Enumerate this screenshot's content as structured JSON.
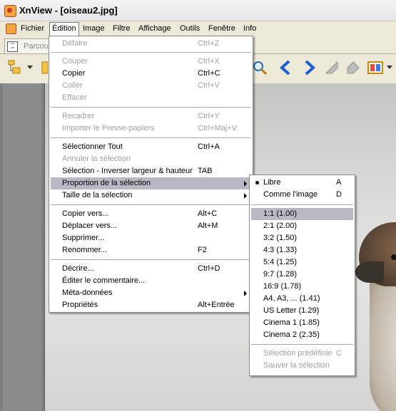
{
  "window": {
    "title": "XnView - [oiseau2.jpg]"
  },
  "menubar": [
    "Fichier",
    "Édition",
    "Image",
    "Filtre",
    "Affichage",
    "Outils",
    "Fenêtre",
    "Info"
  ],
  "tab": {
    "label": "Parcou"
  },
  "toolbar_icons": [
    "folder-tree-icon",
    "open-folder-icon",
    "zoom-icon",
    "prev-arrow-icon",
    "next-arrow-icon",
    "first-icon",
    "last-icon",
    "slideshow-icon"
  ],
  "edit_menu": {
    "items": [
      {
        "label": "Défaire",
        "shortcut": "Ctrl+Z",
        "enabled": false
      },
      {
        "label": "Couper",
        "shortcut": "Ctrl+X",
        "enabled": false
      },
      {
        "label": "Copier",
        "shortcut": "Ctrl+C",
        "enabled": true
      },
      {
        "label": "Coller",
        "shortcut": "Ctrl+V",
        "enabled": false
      },
      {
        "label": "Effacer",
        "shortcut": "",
        "enabled": false
      },
      {
        "label": "Recadrer",
        "shortcut": "Ctrl+Y",
        "enabled": false
      },
      {
        "label": "Importer le Presse-papiers",
        "shortcut": "Ctrl+Maj+V",
        "enabled": false
      },
      {
        "label": "Sélectionner Tout",
        "shortcut": "Ctrl+A",
        "enabled": true
      },
      {
        "label": "Annuler la sélection",
        "shortcut": "",
        "enabled": false
      },
      {
        "label": "Sélection - Inverser largeur & hauteur",
        "shortcut": "TAB",
        "enabled": true
      },
      {
        "label": "Proportion de la sélection",
        "shortcut": "",
        "enabled": true,
        "highlighted": true,
        "submenu": true
      },
      {
        "label": "Taille de la sélection",
        "shortcut": "",
        "enabled": true,
        "submenu": true
      },
      {
        "label": "Copier vers...",
        "shortcut": "Alt+C",
        "enabled": true
      },
      {
        "label": "Déplacer vers...",
        "shortcut": "Alt+M",
        "enabled": true
      },
      {
        "label": "Supprimer...",
        "shortcut": "",
        "enabled": true
      },
      {
        "label": "Renommer...",
        "shortcut": "F2",
        "enabled": true
      },
      {
        "label": "Décrire...",
        "shortcut": "Ctrl+D",
        "enabled": true
      },
      {
        "label": "Éditer le commentaire...",
        "shortcut": "",
        "enabled": true
      },
      {
        "label": "Méta-données",
        "shortcut": "",
        "enabled": true,
        "submenu": true
      },
      {
        "label": "Propriétés",
        "shortcut": "Alt+Entrée",
        "enabled": true
      }
    ]
  },
  "ratio_menu": {
    "items": [
      {
        "label": "Libre",
        "shortcut": "A",
        "enabled": true,
        "checked": true
      },
      {
        "label": "Comme l'image",
        "shortcut": "D",
        "enabled": true
      },
      {
        "label": "1:1 (1.00)",
        "shortcut": "",
        "enabled": true,
        "highlighted": true
      },
      {
        "label": "2:1 (2.00)",
        "shortcut": "",
        "enabled": true
      },
      {
        "label": "3:2 (1.50)",
        "shortcut": "",
        "enabled": true
      },
      {
        "label": "4:3 (1.33)",
        "shortcut": "",
        "enabled": true
      },
      {
        "label": "5:4 (1.25)",
        "shortcut": "",
        "enabled": true
      },
      {
        "label": "9:7 (1.28)",
        "shortcut": "",
        "enabled": true
      },
      {
        "label": "16:9 (1.78)",
        "shortcut": "",
        "enabled": true
      },
      {
        "label": "A4, A3, ... (1.41)",
        "shortcut": "",
        "enabled": true
      },
      {
        "label": "US Letter (1.29)",
        "shortcut": "",
        "enabled": true
      },
      {
        "label": "Cinema 1 (1.85)",
        "shortcut": "",
        "enabled": true
      },
      {
        "label": "Cinema 2 (2.35)",
        "shortcut": "",
        "enabled": true
      },
      {
        "label": "Sélection prédéfinie",
        "shortcut": "C",
        "enabled": false
      },
      {
        "label": "Sauver la sélection",
        "shortcut": "",
        "enabled": false
      }
    ]
  },
  "colors": {
    "highlight": "#b9b9c5",
    "disabled_text": "#a0a0a0",
    "nav_arrow": "#1a5fd6"
  }
}
